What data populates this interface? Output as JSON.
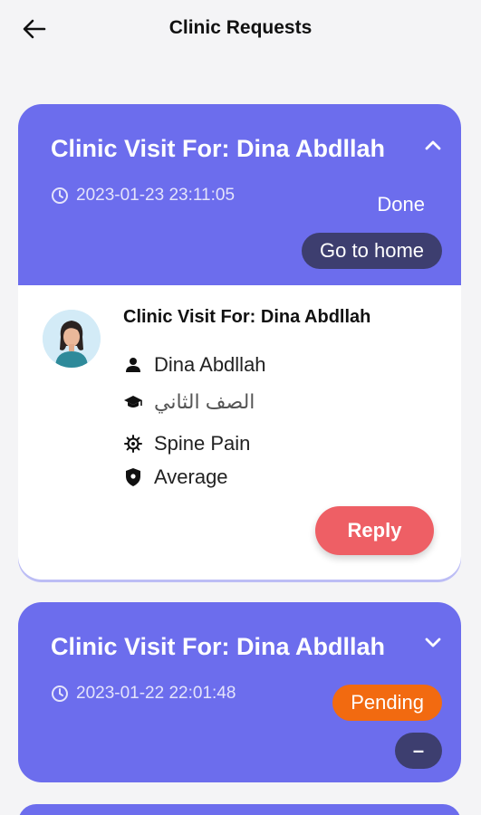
{
  "appbar": {
    "title": "Clinic Requests"
  },
  "requests": [
    {
      "title": "Clinic Visit For: Dina Abdllah",
      "datetime": "2023-01-23 23:11:05",
      "status": "Done",
      "action_label": "Go to home",
      "expanded": true,
      "details": {
        "title": "Clinic Visit For: Dina Abdllah",
        "student_name": "Dina Abdllah",
        "grade": "الصف الثاني",
        "complaint": "Spine Pain",
        "severity": "Average",
        "reply_label": "Reply"
      }
    },
    {
      "title": "Clinic Visit For: Dina Abdllah",
      "datetime": "2023-01-22 22:01:48",
      "status": "Pending",
      "action_label": "–",
      "expanded": false
    }
  ],
  "colors": {
    "card_header": "#6c6ded",
    "pill_dark": "#3d3e6f",
    "pending": "#f26a10",
    "reply": "#ee5f65"
  },
  "icons": {
    "back": "arrow-left-icon",
    "collapse": "chevron-up-icon",
    "expand": "chevron-down-icon",
    "time": "clock-icon",
    "student": "person-icon",
    "grade": "graduation-cap-icon",
    "complaint": "virus-icon",
    "severity": "shield-icon"
  }
}
